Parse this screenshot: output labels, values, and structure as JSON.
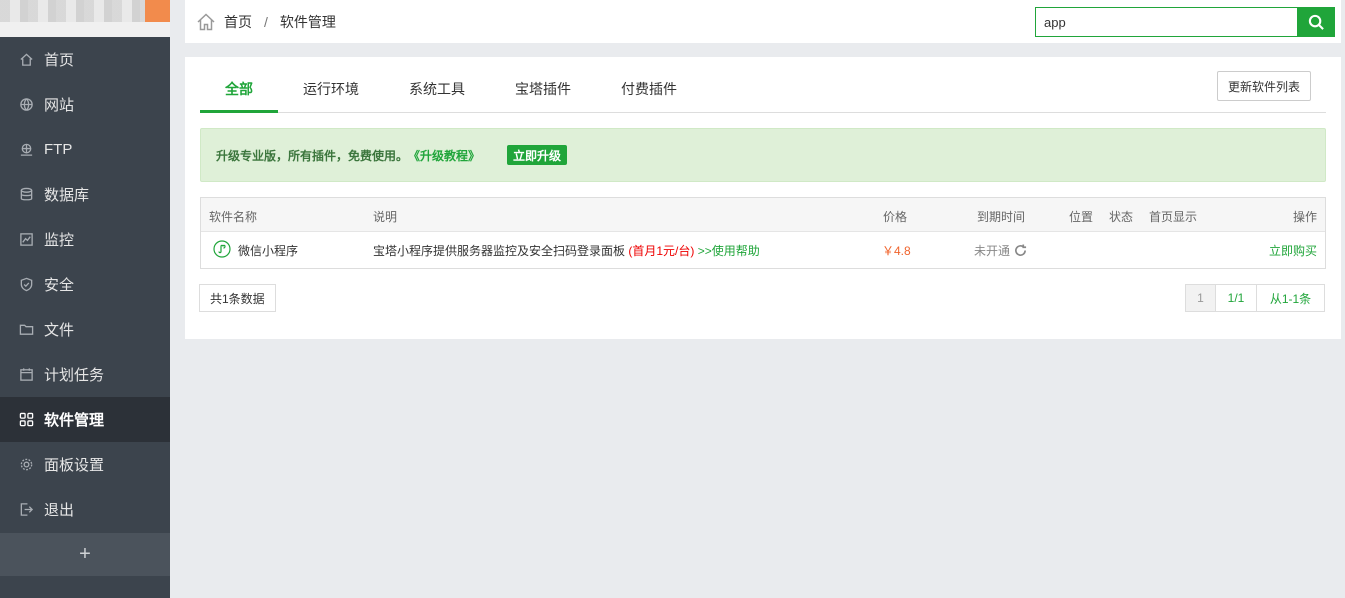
{
  "sidebar": {
    "items": [
      {
        "label": "首页",
        "icon": "home-icon"
      },
      {
        "label": "网站",
        "icon": "globe-icon"
      },
      {
        "label": "FTP",
        "icon": "ftp-icon"
      },
      {
        "label": "数据库",
        "icon": "database-icon"
      },
      {
        "label": "监控",
        "icon": "monitor-icon"
      },
      {
        "label": "安全",
        "icon": "shield-icon"
      },
      {
        "label": "文件",
        "icon": "folder-icon"
      },
      {
        "label": "计划任务",
        "icon": "calendar-icon"
      },
      {
        "label": "软件管理",
        "icon": "apps-icon",
        "active": true
      },
      {
        "label": "面板设置",
        "icon": "gear-icon"
      },
      {
        "label": "退出",
        "icon": "logout-icon"
      }
    ],
    "add_label": "+"
  },
  "breadcrumb": {
    "home": "首页",
    "separator": "/",
    "current": "软件管理"
  },
  "search": {
    "value": "app"
  },
  "tabs": {
    "items": [
      "全部",
      "运行环境",
      "系统工具",
      "宝塔插件",
      "付费插件"
    ],
    "active_index": 0,
    "refresh_label": "更新软件列表"
  },
  "notice": {
    "text": "升级专业版，所有插件，免费使用。",
    "link": "《升级教程》",
    "button": "立即升级"
  },
  "table": {
    "headers": [
      "软件名称",
      "说明",
      "价格",
      "到期时间",
      "位置",
      "状态",
      "首页显示",
      "操作"
    ],
    "rows": [
      {
        "name": "微信小程序",
        "desc": "宝塔小程序提供服务器监控及安全扫码登录面板",
        "desc_promo": "(首月1元/台)",
        "desc_help": ">>使用帮助",
        "price": "￥4.8",
        "expire": "未开通",
        "action": "立即购买"
      }
    ]
  },
  "footer": {
    "total": "共1条数据",
    "pager": {
      "current": "1",
      "pages": "1/1",
      "range": "从1-1条"
    }
  },
  "colors": {
    "accent": "#20a53a",
    "sidebar_bg": "#3c444d",
    "price": "#f0642d",
    "promo": "#e00000"
  }
}
